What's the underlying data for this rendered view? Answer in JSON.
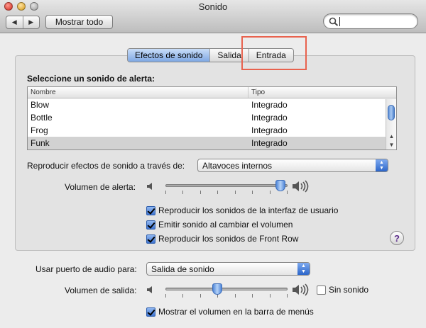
{
  "window": {
    "title": "Sonido",
    "nav_back": "◀",
    "nav_forward": "▶",
    "show_all_label": "Mostrar todo",
    "search_value": ""
  },
  "tabs": [
    {
      "label": "Efectos de sonido",
      "active": true
    },
    {
      "label": "Salida",
      "active": false
    },
    {
      "label": "Entrada",
      "active": false
    }
  ],
  "alerts": {
    "heading": "Seleccione un sonido de alerta:",
    "columns": [
      "Nombre",
      "Tipo"
    ],
    "rows": [
      {
        "name": "Blow",
        "type": "Integrado"
      },
      {
        "name": "Bottle",
        "type": "Integrado"
      },
      {
        "name": "Frog",
        "type": "Integrado"
      },
      {
        "name": "Funk",
        "type": "Integrado",
        "selected": true
      }
    ]
  },
  "play_through": {
    "label": "Reproducir efectos de sonido a través de:",
    "value": "Altavoces internos"
  },
  "alert_volume": {
    "label": "Volumen de alerta:",
    "level": 0.98
  },
  "checkboxes": [
    {
      "label": "Reproducir los sonidos de la interfaz de usuario",
      "checked": true
    },
    {
      "label": "Emitir sonido al cambiar el volumen",
      "checked": true
    },
    {
      "label": "Reproducir los sonidos de Front Row",
      "checked": true
    }
  ],
  "help_label": "?",
  "audio_port": {
    "label": "Usar puerto de audio para:",
    "value": "Salida de sonido"
  },
  "output_volume": {
    "label": "Volumen de salida:",
    "level": 0.42,
    "mute_label": "Sin sonido",
    "mute_checked": false
  },
  "menu_bar_volume": {
    "label": "Mostrar el volumen en la barra de menús",
    "checked": true
  },
  "colors": {
    "accent": "#3f74d0",
    "highlight_box": "#e8624e"
  }
}
